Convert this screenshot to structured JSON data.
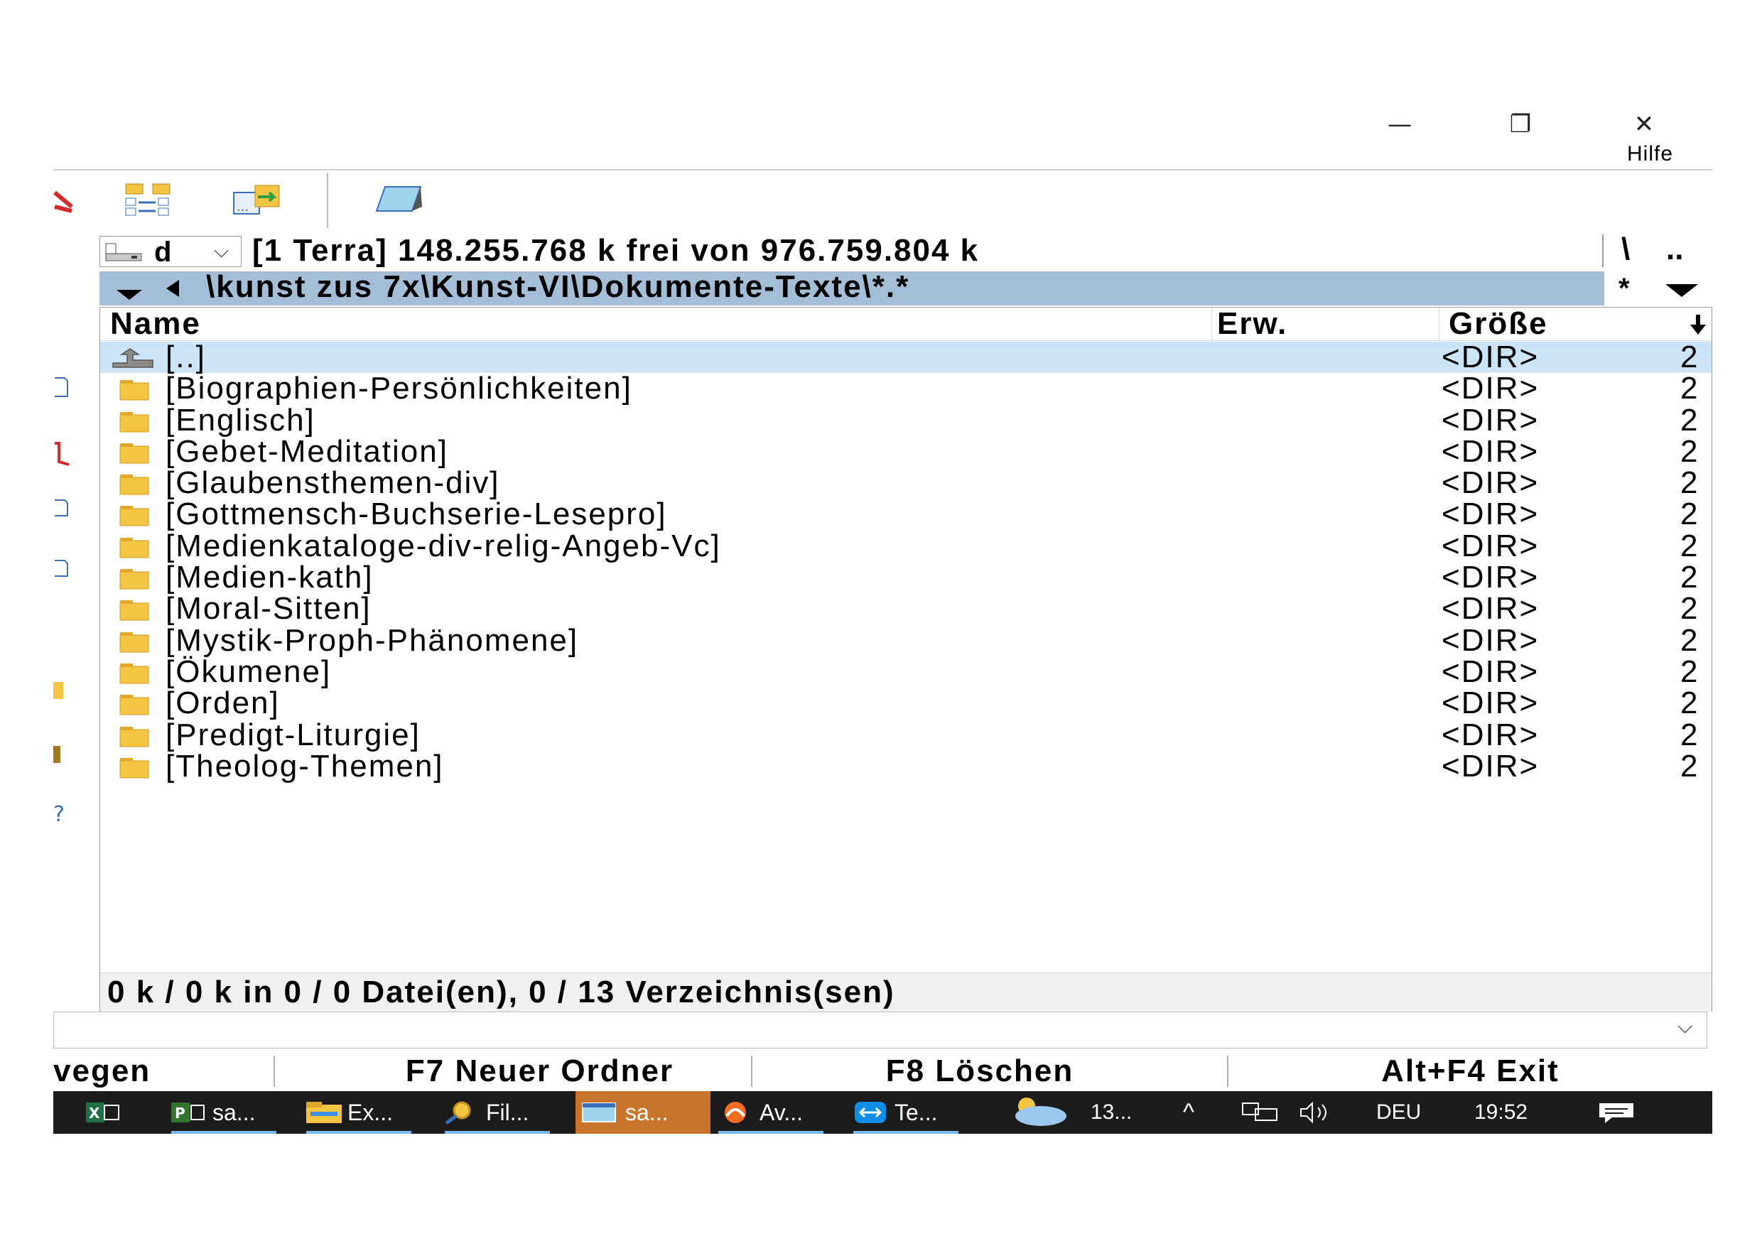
{
  "window": {
    "minimize_glyph": "—",
    "restore_glyph": "❐",
    "close_glyph": "✕",
    "menu_item": "Hilfe"
  },
  "drive_bar": {
    "drive_letter": "d",
    "info": "[1 Terra]  148.255.768 k frei von 976.759.804 k",
    "root_button": "\\",
    "up_button": ".."
  },
  "path_bar": {
    "path": "\\kunst zus 7x\\Kunst-VI\\Dokumente-Texte\\*.*",
    "filter_button": "*"
  },
  "columns": {
    "name": "Name",
    "ext": "Erw.",
    "size": "Größe"
  },
  "files": [
    {
      "name": "[..]",
      "size": "<DIR>",
      "extra": "2",
      "type": "up"
    },
    {
      "name": "[Biographien-Persönlichkeiten]",
      "size": "<DIR>",
      "extra": "2",
      "type": "folder"
    },
    {
      "name": "[Englisch]",
      "size": "<DIR>",
      "extra": "2",
      "type": "folder"
    },
    {
      "name": "[Gebet-Meditation]",
      "size": "<DIR>",
      "extra": "2",
      "type": "folder"
    },
    {
      "name": "[Glaubensthemen-div]",
      "size": "<DIR>",
      "extra": "2",
      "type": "folder"
    },
    {
      "name": "[Gottmensch-Buchserie-Lesepro]",
      "size": "<DIR>",
      "extra": "2",
      "type": "folder"
    },
    {
      "name": "[Medienkataloge-div-relig-Angeb-Vc]",
      "size": "<DIR>",
      "extra": "2",
      "type": "folder"
    },
    {
      "name": "[Medien-kath]",
      "size": "<DIR>",
      "extra": "2",
      "type": "folder"
    },
    {
      "name": "[Moral-Sitten]",
      "size": "<DIR>",
      "extra": "2",
      "type": "folder"
    },
    {
      "name": "[Mystik-Proph-Phänomene]",
      "size": "<DIR>",
      "extra": "2",
      "type": "folder"
    },
    {
      "name": "[Ökumene]",
      "size": "<DIR>",
      "extra": "2",
      "type": "folder"
    },
    {
      "name": "[Orden]",
      "size": "<DIR>",
      "extra": "2",
      "type": "folder"
    },
    {
      "name": "[Predigt-Liturgie]",
      "size": "<DIR>",
      "extra": "2",
      "type": "folder"
    },
    {
      "name": "[Theolog-Themen]",
      "size": "<DIR>",
      "extra": "2",
      "type": "folder"
    }
  ],
  "status": "0 k / 0 k in 0 / 0 Datei(en), 0 / 13 Verzeichnis(sen)",
  "function_keys": {
    "f6": "vegen",
    "f7": "F7 Neuer Ordner",
    "f8": "F8 Löschen",
    "altf4": "Alt+F4 Exit"
  },
  "taskbar": {
    "apps": [
      {
        "label": "",
        "icon": "excel-icon"
      },
      {
        "label": "sa...",
        "icon": "project-icon"
      },
      {
        "label": "Ex...",
        "icon": "explorer-icon"
      },
      {
        "label": "Fil...",
        "icon": "search-icon"
      },
      {
        "label": "sa...",
        "icon": "window-icon"
      },
      {
        "label": "Av...",
        "icon": "avast-icon"
      },
      {
        "label": "Te...",
        "icon": "teamviewer-icon"
      }
    ],
    "weather": "13...",
    "tray_caret": "^",
    "language": "DEU",
    "time": "19:52"
  },
  "colors": {
    "selection": "#cce4f7",
    "path_bar": "#a4bed8",
    "taskbar": "#1c1c1c",
    "active_task": "#c8742c",
    "folder": "#f4c542"
  }
}
